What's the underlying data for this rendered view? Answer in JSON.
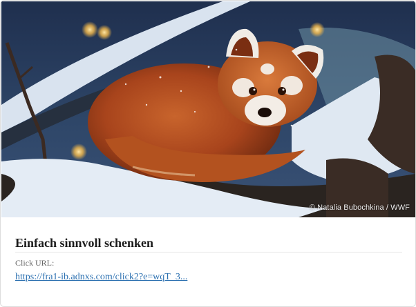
{
  "image": {
    "subject": "red-panda-in-snow",
    "credit": "© Natalia Bubochkina / WWF"
  },
  "content": {
    "title": "Einfach sinnvoll schenken",
    "click_label": "Click URL:",
    "click_url": "https://fra1-ib.adnxs.com/click2?e=wqT_3..."
  },
  "colors": {
    "title": "#1a1a1a",
    "label": "#666666",
    "link": "#2a6fb0",
    "border": "#dcdcdc"
  }
}
